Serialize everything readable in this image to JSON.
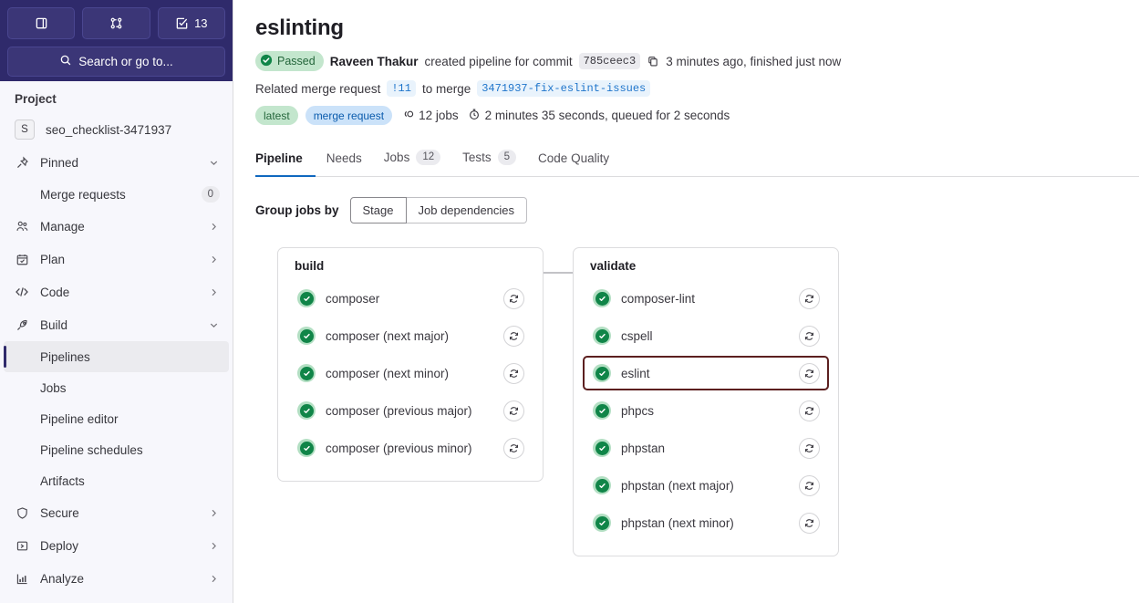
{
  "sidebar": {
    "top_buttons": [
      {
        "name": "issues-panel-toggle",
        "label": ""
      },
      {
        "name": "merge-requests",
        "label": ""
      },
      {
        "name": "todos",
        "label": "13"
      }
    ],
    "search_placeholder": "Search or go to...",
    "section_title": "Project",
    "project": {
      "initial": "S",
      "name": "seo_checklist-3471937"
    },
    "items": [
      {
        "label": "Pinned",
        "icon": "pin-icon",
        "expandable": true,
        "expanded": true
      },
      {
        "label": "Merge requests",
        "icon": "",
        "sub": true,
        "badge": "0"
      },
      {
        "label": "Manage",
        "icon": "users-icon",
        "expandable": true
      },
      {
        "label": "Plan",
        "icon": "calendar-icon",
        "expandable": true
      },
      {
        "label": "Code",
        "icon": "code-icon",
        "expandable": true
      },
      {
        "label": "Build",
        "icon": "rocket-icon",
        "expandable": true,
        "expanded": true
      },
      {
        "label": "Pipelines",
        "sub": true,
        "active": true
      },
      {
        "label": "Jobs",
        "sub": true
      },
      {
        "label": "Pipeline editor",
        "sub": true
      },
      {
        "label": "Pipeline schedules",
        "sub": true
      },
      {
        "label": "Artifacts",
        "sub": true
      },
      {
        "label": "Secure",
        "icon": "shield-icon",
        "expandable": true
      },
      {
        "label": "Deploy",
        "icon": "deploy-icon",
        "expandable": true
      },
      {
        "label": "Analyze",
        "icon": "chart-icon",
        "expandable": true
      }
    ]
  },
  "header": {
    "title": "eslinting",
    "status": "Passed",
    "author": "Raveen Thakur",
    "created_text": "created pipeline for commit",
    "commit_sha": "785ceec3",
    "time_text": "3 minutes ago, finished just now",
    "related_label": "Related merge request",
    "mr_ref": "!11",
    "to_merge_label": "to merge",
    "branch": "3471937-fix-eslint-issues",
    "tag_latest": "latest",
    "tag_merge_request": "merge request",
    "jobs_count_text": "12 jobs",
    "duration_text": "2 minutes 35 seconds, queued for 2 seconds"
  },
  "tabs": [
    {
      "label": "Pipeline",
      "count": "",
      "active": true
    },
    {
      "label": "Needs",
      "count": ""
    },
    {
      "label": "Jobs",
      "count": "12"
    },
    {
      "label": "Tests",
      "count": "5"
    },
    {
      "label": "Code Quality",
      "count": ""
    }
  ],
  "groupby": {
    "label": "Group jobs by",
    "options": [
      {
        "label": "Stage",
        "active": true
      },
      {
        "label": "Job dependencies",
        "active": false
      }
    ]
  },
  "graph": {
    "stages": [
      {
        "name": "build",
        "jobs": [
          {
            "name": "composer",
            "status": "passed"
          },
          {
            "name": "composer (next major)",
            "status": "passed"
          },
          {
            "name": "composer (next minor)",
            "status": "passed"
          },
          {
            "name": "composer (previous major)",
            "status": "passed"
          },
          {
            "name": "composer (previous minor)",
            "status": "passed"
          }
        ]
      },
      {
        "name": "validate",
        "jobs": [
          {
            "name": "composer-lint",
            "status": "passed"
          },
          {
            "name": "cspell",
            "status": "passed"
          },
          {
            "name": "eslint",
            "status": "passed",
            "highlighted": true
          },
          {
            "name": "phpcs",
            "status": "passed"
          },
          {
            "name": "phpstan",
            "status": "passed"
          },
          {
            "name": "phpstan (next major)",
            "status": "passed"
          },
          {
            "name": "phpstan (next minor)",
            "status": "passed"
          }
        ]
      }
    ]
  },
  "colors": {
    "sidebar_header": "#2f2a6b",
    "success_green": "#108548",
    "accent_blue": "#1f75cb",
    "highlight_outline": "#5c1f1f"
  }
}
